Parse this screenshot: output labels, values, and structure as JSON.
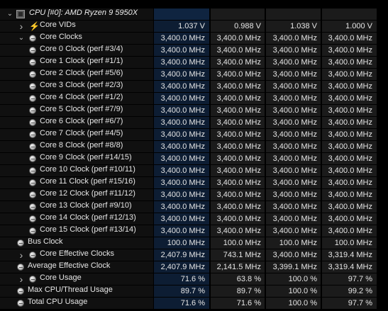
{
  "header": {
    "label": "CPU [#0]: AMD Ryzen 9 5950X"
  },
  "rows": [
    {
      "label": "Core VIDs",
      "values": [
        "1.037 V",
        "0.988 V",
        "1.038 V",
        "1.000 V"
      ],
      "icon": "lightning-icon",
      "expander": "collapsed"
    },
    {
      "label": "Core Clocks",
      "values": [
        "3,400.0 MHz",
        "3,400.0 MHz",
        "3,400.0 MHz",
        "3,400.0 MHz"
      ],
      "icon": "gauge-icon",
      "expander": "expanded"
    },
    {
      "label": "Core 0 Clock (perf #3/4)",
      "values": [
        "3,400.0 MHz",
        "3,400.0 MHz",
        "3,400.0 MHz",
        "3,400.0 MHz"
      ],
      "icon": "gauge-icon"
    },
    {
      "label": "Core 1 Clock (perf #1/1)",
      "values": [
        "3,400.0 MHz",
        "3,400.0 MHz",
        "3,400.0 MHz",
        "3,400.0 MHz"
      ],
      "icon": "gauge-icon"
    },
    {
      "label": "Core 2 Clock (perf #5/6)",
      "values": [
        "3,400.0 MHz",
        "3,400.0 MHz",
        "3,400.0 MHz",
        "3,400.0 MHz"
      ],
      "icon": "gauge-icon"
    },
    {
      "label": "Core 3 Clock (perf #2/3)",
      "values": [
        "3,400.0 MHz",
        "3,400.0 MHz",
        "3,400.0 MHz",
        "3,400.0 MHz"
      ],
      "icon": "gauge-icon"
    },
    {
      "label": "Core 4 Clock (perf #1/2)",
      "values": [
        "3,400.0 MHz",
        "3,400.0 MHz",
        "3,400.0 MHz",
        "3,400.0 MHz"
      ],
      "icon": "gauge-icon"
    },
    {
      "label": "Core 5 Clock (perf #7/9)",
      "values": [
        "3,400.0 MHz",
        "3,400.0 MHz",
        "3,400.0 MHz",
        "3,400.0 MHz"
      ],
      "icon": "gauge-icon"
    },
    {
      "label": "Core 6 Clock (perf #6/7)",
      "values": [
        "3,400.0 MHz",
        "3,400.0 MHz",
        "3,400.0 MHz",
        "3,400.0 MHz"
      ],
      "icon": "gauge-icon"
    },
    {
      "label": "Core 7 Clock (perf #4/5)",
      "values": [
        "3,400.0 MHz",
        "3,400.0 MHz",
        "3,400.0 MHz",
        "3,400.0 MHz"
      ],
      "icon": "gauge-icon"
    },
    {
      "label": "Core 8 Clock (perf #8/8)",
      "values": [
        "3,400.0 MHz",
        "3,400.0 MHz",
        "3,400.0 MHz",
        "3,400.0 MHz"
      ],
      "icon": "gauge-icon"
    },
    {
      "label": "Core 9 Clock (perf #14/15)",
      "values": [
        "3,400.0 MHz",
        "3,400.0 MHz",
        "3,400.0 MHz",
        "3,400.0 MHz"
      ],
      "icon": "gauge-icon"
    },
    {
      "label": "Core 10 Clock (perf #10/11)",
      "values": [
        "3,400.0 MHz",
        "3,400.0 MHz",
        "3,400.0 MHz",
        "3,400.0 MHz"
      ],
      "icon": "gauge-icon"
    },
    {
      "label": "Core 11 Clock (perf #15/16)",
      "values": [
        "3,400.0 MHz",
        "3,400.0 MHz",
        "3,400.0 MHz",
        "3,400.0 MHz"
      ],
      "icon": "gauge-icon"
    },
    {
      "label": "Core 12 Clock (perf #11/12)",
      "values": [
        "3,400.0 MHz",
        "3,400.0 MHz",
        "3,400.0 MHz",
        "3,400.0 MHz"
      ],
      "icon": "gauge-icon"
    },
    {
      "label": "Core 13 Clock (perf #9/10)",
      "values": [
        "3,400.0 MHz",
        "3,400.0 MHz",
        "3,400.0 MHz",
        "3,400.0 MHz"
      ],
      "icon": "gauge-icon"
    },
    {
      "label": "Core 14 Clock (perf #12/13)",
      "values": [
        "3,400.0 MHz",
        "3,400.0 MHz",
        "3,400.0 MHz",
        "3,400.0 MHz"
      ],
      "icon": "gauge-icon"
    },
    {
      "label": "Core 15 Clock (perf #13/14)",
      "values": [
        "3,400.0 MHz",
        "3,400.0 MHz",
        "3,400.0 MHz",
        "3,400.0 MHz"
      ],
      "icon": "gauge-icon"
    },
    {
      "label": "Bus Clock",
      "values": [
        "100.0 MHz",
        "100.0 MHz",
        "100.0 MHz",
        "100.0 MHz"
      ],
      "icon": "gauge-icon"
    },
    {
      "label": "Core Effective Clocks",
      "values": [
        "2,407.9 MHz",
        "743.1 MHz",
        "3,400.0 MHz",
        "3,319.4 MHz"
      ],
      "icon": "gauge-icon",
      "expander": "collapsed"
    },
    {
      "label": "Average Effective Clock",
      "values": [
        "2,407.9 MHz",
        "2,141.5 MHz",
        "3,399.1 MHz",
        "3,319.4 MHz"
      ],
      "icon": "gauge-icon"
    },
    {
      "label": "Core Usage",
      "values": [
        "71.6 %",
        "63.8 %",
        "100.0 %",
        "97.7 %"
      ],
      "icon": "gauge-icon",
      "expander": "collapsed"
    },
    {
      "label": "Max CPU/Thread Usage",
      "values": [
        "89.7 %",
        "89.7 %",
        "100.0 %",
        "99.2 %"
      ],
      "icon": "gauge-icon"
    },
    {
      "label": "Total CPU Usage",
      "values": [
        "71.6 %",
        "71.6 %",
        "100.0 %",
        "97.7 %"
      ],
      "icon": "gauge-icon"
    }
  ]
}
